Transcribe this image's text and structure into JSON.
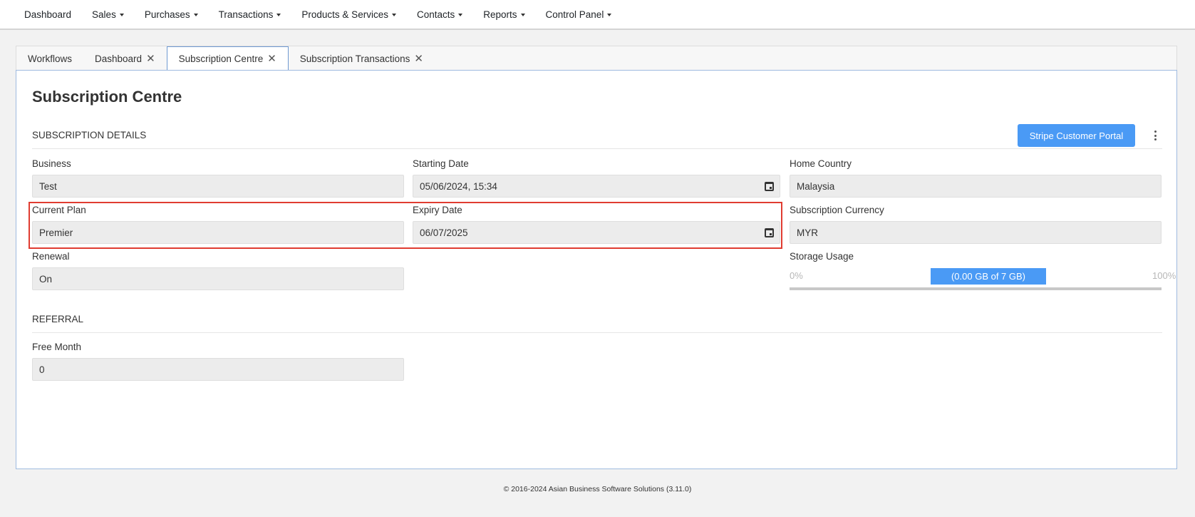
{
  "nav": {
    "items": [
      {
        "label": "Dashboard",
        "dropdown": false
      },
      {
        "label": "Sales",
        "dropdown": true
      },
      {
        "label": "Purchases",
        "dropdown": true
      },
      {
        "label": "Transactions",
        "dropdown": true
      },
      {
        "label": "Products & Services",
        "dropdown": true
      },
      {
        "label": "Contacts",
        "dropdown": true
      },
      {
        "label": "Reports",
        "dropdown": true
      },
      {
        "label": "Control Panel",
        "dropdown": true
      }
    ]
  },
  "tabs": [
    {
      "label": "Workflows",
      "closable": false,
      "active": false
    },
    {
      "label": "Dashboard",
      "closable": true,
      "active": false
    },
    {
      "label": "Subscription Centre",
      "closable": true,
      "active": true
    },
    {
      "label": "Subscription Transactions",
      "closable": true,
      "active": false
    }
  ],
  "page": {
    "title": "Subscription Centre",
    "subscription_section": "SUBSCRIPTION DETAILS",
    "stripe_button": "Stripe Customer Portal",
    "referral_section": "REFERRAL"
  },
  "fields": {
    "business": {
      "label": "Business",
      "value": "Test"
    },
    "starting_date": {
      "label": "Starting Date",
      "value": "05/06/2024, 15:34"
    },
    "home_country": {
      "label": "Home Country",
      "value": "Malaysia"
    },
    "current_plan": {
      "label": "Current Plan",
      "value": "Premier"
    },
    "expiry_date": {
      "label": "Expiry Date",
      "value": "06/07/2025"
    },
    "subscription_currency": {
      "label": "Subscription Currency",
      "value": "MYR"
    },
    "renewal": {
      "label": "Renewal",
      "value": "On"
    },
    "storage_usage": {
      "label": "Storage Usage",
      "min": "0%",
      "max": "100%",
      "usage_text": "(0.00 GB of 7 GB)",
      "used_fraction": 0.0
    },
    "free_month": {
      "label": "Free Month",
      "value": "0"
    }
  },
  "colors": {
    "accent": "#4a9af5",
    "highlight": "#e03c31"
  },
  "footer": {
    "text": "© 2016-2024 Asian Business Software Solutions (3.11.0)"
  }
}
